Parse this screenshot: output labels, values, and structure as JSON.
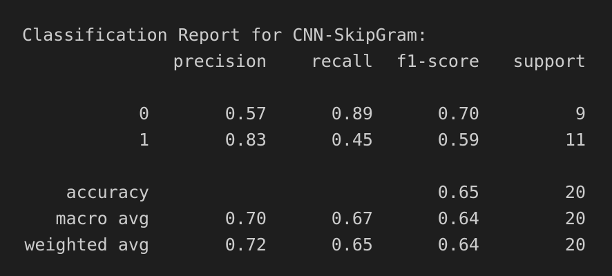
{
  "report": {
    "title": "Classification Report for CNN-SkipGram:",
    "headers": {
      "precision": "precision",
      "recall": "recall",
      "f1": "f1-score",
      "support": "support"
    },
    "rows": [
      {
        "label": "0",
        "precision": "0.57",
        "recall": "0.89",
        "f1": "0.70",
        "support": "9"
      },
      {
        "label": "1",
        "precision": "0.83",
        "recall": "0.45",
        "f1": "0.59",
        "support": "11"
      }
    ],
    "summary": [
      {
        "label": "accuracy",
        "precision": "",
        "recall": "",
        "f1": "0.65",
        "support": "20"
      },
      {
        "label": "macro avg",
        "precision": "0.70",
        "recall": "0.67",
        "f1": "0.64",
        "support": "20"
      },
      {
        "label": "weighted avg",
        "precision": "0.72",
        "recall": "0.65",
        "f1": "0.64",
        "support": "20"
      }
    ]
  },
  "colors": {
    "background": "#1e1e1e",
    "text": "#cccccc"
  }
}
